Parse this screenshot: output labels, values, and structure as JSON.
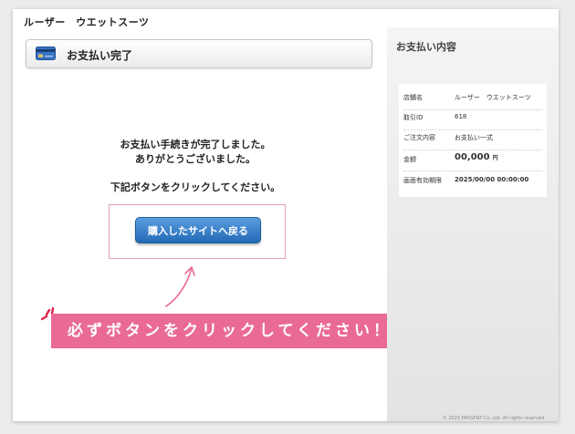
{
  "shop_name": "ルーザー　ウエットスーツ",
  "header": {
    "title": "お支払い完了",
    "icon": "credit-card-icon"
  },
  "message": {
    "line1": "お支払い手続きが完了しました。",
    "line2": "ありがとうございました。",
    "line3": "下記ボタンをクリックしてください。"
  },
  "return_button_label": "購入したサイトへ戻る",
  "banner_text": "必ずボタンをクリックしてください！",
  "sidebar": {
    "title": "お支払い内容",
    "rows": [
      {
        "label": "店舗名",
        "value": "ルーザー　ウエットスーツ"
      },
      {
        "label": "取引ID",
        "value": "618"
      },
      {
        "label": "ご注文内容",
        "value": "お支払い一式"
      },
      {
        "label": "金額",
        "value": "00,000",
        "unit": "円"
      },
      {
        "label": "画面有効期限",
        "value": "2025/00/00 00:00:00"
      }
    ],
    "footer": "© 2025 PAYGENT Co.,Ltd. All rights reserved."
  },
  "colors": {
    "accent_pink": "#ea6a97",
    "button_blue": "#2469b5"
  }
}
